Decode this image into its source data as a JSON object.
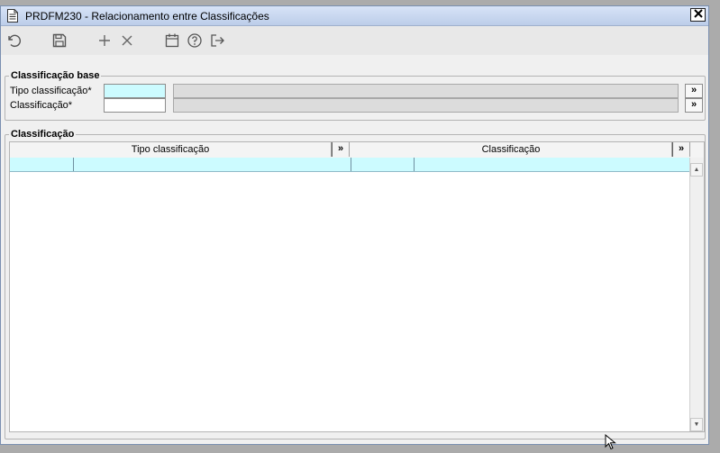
{
  "window": {
    "title": "PRDFM230 - Relacionamento entre Classificações",
    "close_glyph": "✕"
  },
  "toolbar": {
    "icons": [
      "undo-icon",
      "save-icon",
      "add-icon",
      "delete-icon",
      "calendar-icon",
      "help-icon",
      "exit-icon"
    ]
  },
  "base_group": {
    "legend": "Classificação base",
    "tipo_label": "Tipo classificação*",
    "tipo_code": "",
    "tipo_desc": "",
    "class_label": "Classificação*",
    "class_code": "",
    "class_desc": "",
    "lookup_glyph": "»"
  },
  "grid_group": {
    "legend": "Classificação",
    "columns": [
      "Tipo classificação",
      "Classificação"
    ],
    "expand_glyph": "»",
    "rows": [
      [
        "",
        "",
        "",
        ""
      ]
    ]
  },
  "scrollbar": {
    "up_glyph": "▲",
    "down_glyph": "▼"
  },
  "colors": {
    "required_field": "#ccfbff",
    "selected_row": "#ccfbff",
    "titlebar": "#c5d6ef"
  }
}
